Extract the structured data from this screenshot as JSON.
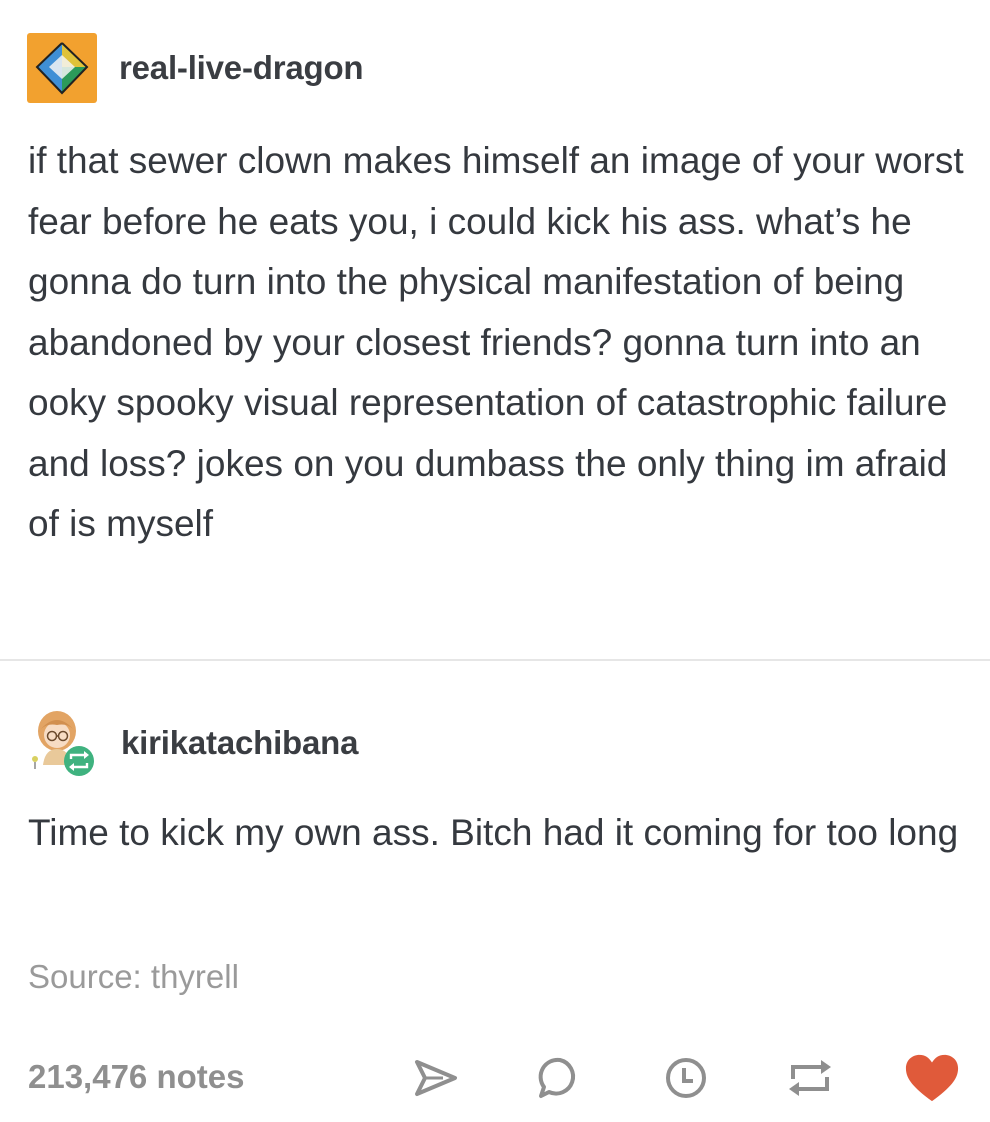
{
  "original_post": {
    "blog_name": "real-live-dragon",
    "avatar_icon": "d20-dice-icon",
    "avatar_color": "#f2a12f",
    "text": "if that sewer clown makes himself an image of your worst fear before he eats you, i could kick his ass. what’s he gonna do turn into the physical manifestation of being abandoned by your closest friends? gonna turn into an ooky spooky visual representation of catastrophic failure and loss? jokes on you dumbass the only thing im afraid of is myself"
  },
  "reblog": {
    "blog_name": "kirikatachibana",
    "avatar_icon": "anime-character-avatar",
    "badge_icon": "reblog-badge-icon",
    "badge_color": "#3fb27f",
    "text": "Time to kick my own ass. Bitch had it coming for too long"
  },
  "source": {
    "label": "Source:",
    "name": "thyrell"
  },
  "footer": {
    "notes_count": "213,476 notes",
    "controls": [
      "share-icon",
      "reply-icon",
      "queue-icon",
      "reblog-icon",
      "like-heart-icon"
    ],
    "like_color": "#e05a3a",
    "icon_color": "#8f8f8f"
  }
}
